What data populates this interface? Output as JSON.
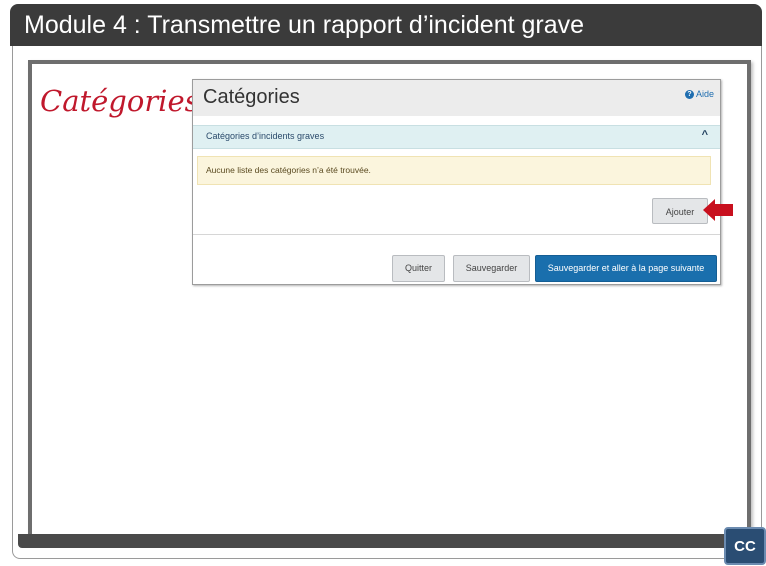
{
  "title_bar": {
    "text": "Module 4 : Transmettre un rapport d’incident grave"
  },
  "slide": {
    "label": "Catégories"
  },
  "app": {
    "heading": "Catégories",
    "help_label": "Aide",
    "accordion_label": "Catégories d’incidents graves",
    "alert_text": "Aucune liste des catégories n’a été trouvée.",
    "add_button": "Ajouter",
    "quit_button": "Quitter",
    "save_button": "Sauvegarder",
    "save_next_button": "Sauvegarder et aller à la page suivante"
  },
  "cc_button": "CC",
  "colors": {
    "title_bar": "#3b3b3b",
    "label_red": "#c0182c",
    "primary_blue": "#1a6fad",
    "accordion_bg": "#dff0f2",
    "alert_bg": "#fbf5dd",
    "pointer_red": "#c8101e"
  },
  "icons": {
    "help": "question-circle-icon",
    "accordion_toggle": "chevron-up-icon",
    "pointer": "red-arrow-pointer-icon"
  }
}
